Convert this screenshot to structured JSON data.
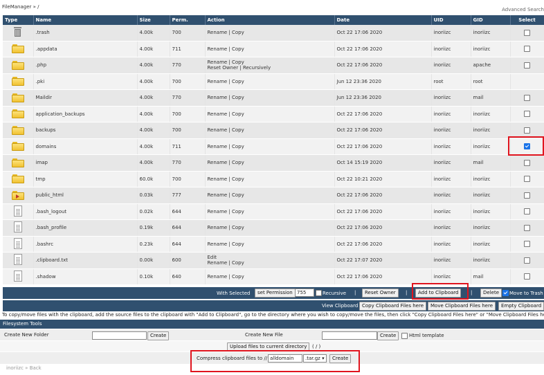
{
  "header": {
    "breadcrumb": "FileManager » /",
    "advanced_search": "Advanced Search"
  },
  "columns": [
    "Type",
    "Name",
    "Size",
    "Perm.",
    "Action",
    "Date",
    "UID",
    "GID",
    "Select"
  ],
  "rows": [
    {
      "icon": "trash-icon",
      "name": ".trash",
      "size": "4.00k",
      "perm": "700",
      "action1": "Rename | Copy",
      "action2": "",
      "date": "Oct 22 17:06 2020",
      "uid": "inoriizc",
      "gid": "inoriizc",
      "checked": false,
      "has_checkbox": true
    },
    {
      "icon": "folder-icon",
      "name": ".appdata",
      "size": "4.00k",
      "perm": "711",
      "action1": "Rename | Copy",
      "action2": "",
      "date": "Oct 22 17:06 2020",
      "uid": "inoriizc",
      "gid": "inoriizc",
      "checked": false,
      "has_checkbox": true
    },
    {
      "icon": "folder-icon",
      "name": ".php",
      "size": "4.00k",
      "perm": "770",
      "action1": "Rename | Copy",
      "action2": "Reset Owner | Recursively",
      "date": "Oct 22 17:06 2020",
      "uid": "inoriizc",
      "gid": "apache",
      "checked": false,
      "has_checkbox": true
    },
    {
      "icon": "folder-icon",
      "name": ".pki",
      "size": "4.00k",
      "perm": "700",
      "action1": "Rename | Copy",
      "action2": "",
      "date": "Jun 12 23:36 2020",
      "uid": "root",
      "gid": "root",
      "checked": false,
      "has_checkbox": false
    },
    {
      "icon": "folder-icon",
      "name": "Maildir",
      "size": "4.00k",
      "perm": "770",
      "action1": "Rename | Copy",
      "action2": "",
      "date": "Jun 12 23:36 2020",
      "uid": "inoriizc",
      "gid": "mail",
      "checked": false,
      "has_checkbox": true
    },
    {
      "icon": "folder-icon",
      "name": "application_backups",
      "size": "4.00k",
      "perm": "700",
      "action1": "Rename | Copy",
      "action2": "",
      "date": "Oct 22 17:06 2020",
      "uid": "inoriizc",
      "gid": "inoriizc",
      "checked": false,
      "has_checkbox": true
    },
    {
      "icon": "folder-icon",
      "name": "backups",
      "size": "4.00k",
      "perm": "700",
      "action1": "Rename | Copy",
      "action2": "",
      "date": "Oct 22 17:06 2020",
      "uid": "inoriizc",
      "gid": "inoriizc",
      "checked": false,
      "has_checkbox": true
    },
    {
      "icon": "folder-icon",
      "name": "domains",
      "size": "4.00k",
      "perm": "711",
      "action1": "Rename | Copy",
      "action2": "",
      "date": "Oct 22 17:06 2020",
      "uid": "inoriizc",
      "gid": "inoriizc",
      "checked": true,
      "has_checkbox": true
    },
    {
      "icon": "folder-icon",
      "name": "imap",
      "size": "4.00k",
      "perm": "770",
      "action1": "Rename | Copy",
      "action2": "",
      "date": "Oct 14 15:19 2020",
      "uid": "inoriizc",
      "gid": "mail",
      "checked": false,
      "has_checkbox": true
    },
    {
      "icon": "folder-icon",
      "name": "tmp",
      "size": "60.0k",
      "perm": "700",
      "action1": "Rename | Copy",
      "action2": "",
      "date": "Oct 22 10:21 2020",
      "uid": "inoriizc",
      "gid": "inoriizc",
      "checked": false,
      "has_checkbox": true
    },
    {
      "icon": "symlink-folder-icon",
      "name": "public_html",
      "size": "0.03k",
      "perm": "777",
      "action1": "Rename | Copy",
      "action2": "",
      "date": "Oct 22 17:06 2020",
      "uid": "inoriizc",
      "gid": "inoriizc",
      "checked": false,
      "has_checkbox": true
    },
    {
      "icon": "file-icon",
      "name": ".bash_logout",
      "size": "0.02k",
      "perm": "644",
      "action1": "Rename | Copy",
      "action2": "",
      "date": "Oct 22 17:06 2020",
      "uid": "inoriizc",
      "gid": "inoriizc",
      "checked": false,
      "has_checkbox": true
    },
    {
      "icon": "file-icon",
      "name": ".bash_profile",
      "size": "0.19k",
      "perm": "644",
      "action1": "Rename | Copy",
      "action2": "",
      "date": "Oct 22 17:06 2020",
      "uid": "inoriizc",
      "gid": "inoriizc",
      "checked": false,
      "has_checkbox": true
    },
    {
      "icon": "file-icon",
      "name": ".bashrc",
      "size": "0.23k",
      "perm": "644",
      "action1": "Rename | Copy",
      "action2": "",
      "date": "Oct 22 17:06 2020",
      "uid": "inoriizc",
      "gid": "inoriizc",
      "checked": false,
      "has_checkbox": true
    },
    {
      "icon": "file-icon",
      "name": ".clipboard.txt",
      "size": "0.00k",
      "perm": "600",
      "action1": "Edit",
      "action2": "Rename | Copy",
      "date": "Oct 22 17:07 2020",
      "uid": "inoriizc",
      "gid": "inoriizc",
      "checked": false,
      "has_checkbox": true
    },
    {
      "icon": "file-icon",
      "name": ".shadow",
      "size": "0.10k",
      "perm": "640",
      "action1": "Rename | Copy",
      "action2": "",
      "date": "Oct 22 17:06 2020",
      "uid": "inoriizc",
      "gid": "mail",
      "checked": false,
      "has_checkbox": true
    }
  ],
  "selected_bar": {
    "with_selected": "With Selected",
    "set_permission": "set Permission",
    "permission_value": "755",
    "recursive": "Recursive",
    "reset_owner": "Reset Owner",
    "add_to_clipboard": "Add to Clipboard",
    "delete": "Delete",
    "move_to_trash": "Move to Trash",
    "move_to_trash_checked": true
  },
  "clipboard_bar": {
    "view_clipboard": "View Clipboard",
    "copy_here": "Copy Clipboard Files here",
    "move_here": "Move Clipboard Files here",
    "empty": "Empty Clipboard"
  },
  "help_text": "To copy/move files with the clipboard, add the source files to the clipboard with \"Add to Clipboard\", go to the directory where you wish to copy/move the files, then click \"Copy Clipboard Files here\" or \"Move Clipboard Files here\"",
  "fs_tools": {
    "title": "Filesystem Tools",
    "new_folder_label": "Create New Folder",
    "new_folder_value": "",
    "create": "Create",
    "new_file_label": "Create New File",
    "new_file_value": "",
    "html_template": "Html template",
    "upload": "Upload files to current directory",
    "upload_path": "( / )",
    "compress_label": "Compress clipboard files to //",
    "compress_name": "alldomain",
    "compress_ext": ".tar.gz"
  },
  "footer": "inoriizc » Back",
  "colors": {
    "header_bg": "#30506f",
    "highlight": "#e0141e",
    "checkbox_on": "#1a73e8"
  }
}
